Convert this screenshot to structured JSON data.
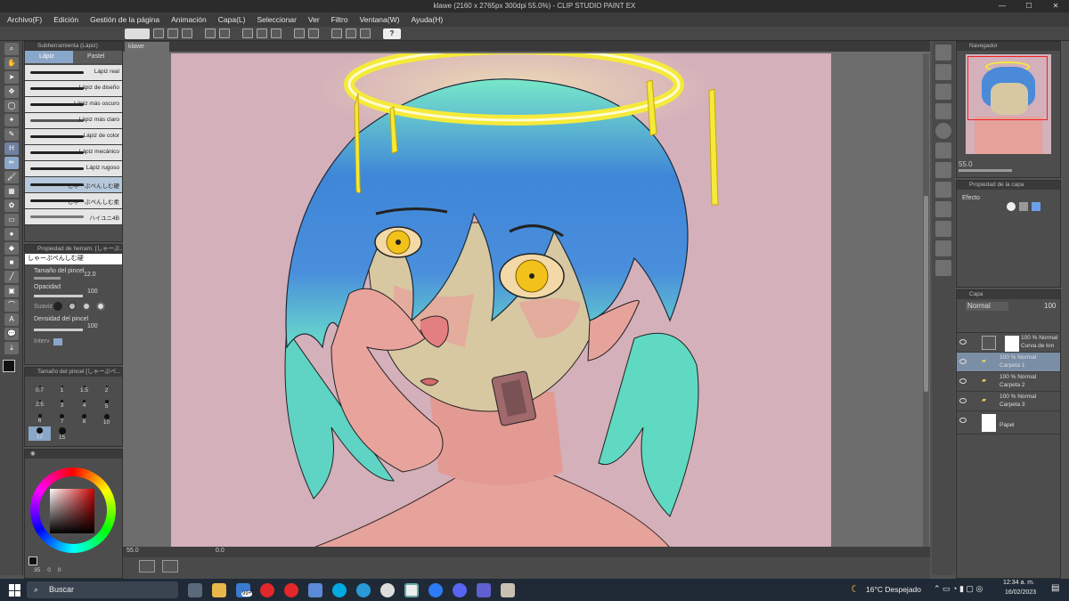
{
  "window": {
    "title": "klawe (2160 x 2765px 300dpi 55.0%) - CLIP STUDIO PAINT EX"
  },
  "menu": [
    "Archivo(F)",
    "Edición",
    "Gestión de la página",
    "Animación",
    "Capa(L)",
    "Seleccionar",
    "Ver",
    "Filtro",
    "Ventana(W)",
    "Ayuda(H)"
  ],
  "subtool": {
    "header": "Subherramienta (Lápiz)",
    "tabs": [
      "Lápiz",
      "Pastel"
    ],
    "brushes": [
      "Lápiz real",
      "Lápiz de diseño",
      "Lápiz más oscuro",
      "Lápiz más claro",
      "Lápiz de color",
      "Lápiz mecánico",
      "Lápiz rugoso",
      "しゃーぷぺんしむ硬",
      "しゃーぷぺんしむ柔",
      "ハイユニ4B"
    ],
    "selected_index": 7
  },
  "tool_property": {
    "header": "Propiedad de herram. [しゃーぷ...",
    "brush_name": "しゃーぷぺんしむ硬",
    "size_label": "Tamaño del pincel",
    "size_value": "12.0",
    "opacity_label": "Opacidad",
    "opacity_value": "100",
    "smooth_label": "Suaviz",
    "density_label": "Densidad del pincel",
    "density_value": "100",
    "interval_label": "Interv"
  },
  "brush_size": {
    "header": "Tamaño del pincel [しゃーぷペ...",
    "sizes": [
      "0.7",
      "1",
      "1.5",
      "2",
      "2.5",
      "3",
      "4",
      "5",
      "6",
      "7",
      "8",
      "10",
      "12",
      "15",
      "17"
    ]
  },
  "color": {
    "values": [
      "35",
      "0",
      "0"
    ]
  },
  "document": {
    "tab": "klawe",
    "zoom": "55.0",
    "angle": "0.0"
  },
  "navigator": {
    "header": "Navegador",
    "zoom": "55.0"
  },
  "layer_property": {
    "header": "Propiedad de la capa",
    "effect_label": "Efecto"
  },
  "layers": {
    "header": "Capa",
    "blend": "Normal",
    "opacity": "100",
    "items": [
      {
        "mode": "100 % Normal",
        "name": "Curva de ton",
        "kind": "adjust"
      },
      {
        "mode": "100 % Normal",
        "name": "Carpeta 1",
        "kind": "folder",
        "selected": true
      },
      {
        "mode": "100 % Normal",
        "name": "Carpeta 2",
        "kind": "folder"
      },
      {
        "mode": "100 % Normal",
        "name": "Carpeta 3",
        "kind": "folder"
      },
      {
        "mode": "",
        "name": "Papel",
        "kind": "paper"
      }
    ]
  },
  "taskbar": {
    "search": "Buscar",
    "badge": "99+",
    "weather": "16°C Despejado",
    "time": "12:34 a. m.",
    "date": "16/02/2023"
  },
  "colors": {
    "canvas_bg": "#d4b0ba",
    "halo": "#f5ea3a",
    "hair_blue": "#3c7dd6",
    "hair_cyan": "#5fe3c8",
    "skin": "#e49a93",
    "eye": "#f2c21a"
  }
}
